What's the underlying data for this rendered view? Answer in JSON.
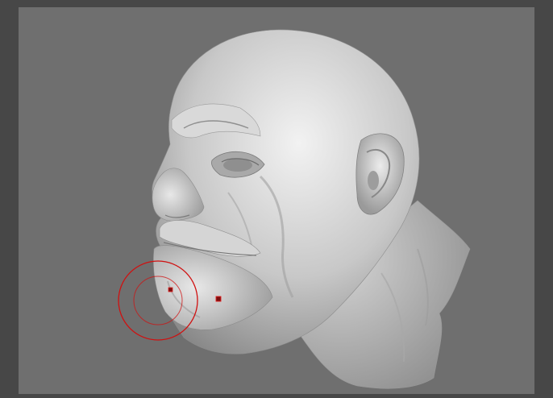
{
  "app": {
    "document_title": "",
    "canvas_background": "#6f6f6f",
    "frame_color": "#474747"
  },
  "model": {
    "type": "sculpted-head",
    "material_color": "#c9c9c9"
  },
  "brush": {
    "cursor_color": "#d01010",
    "cursor_shape": "double-ring",
    "markers": [
      "brush-marker-primary",
      "brush-marker-secondary"
    ]
  }
}
